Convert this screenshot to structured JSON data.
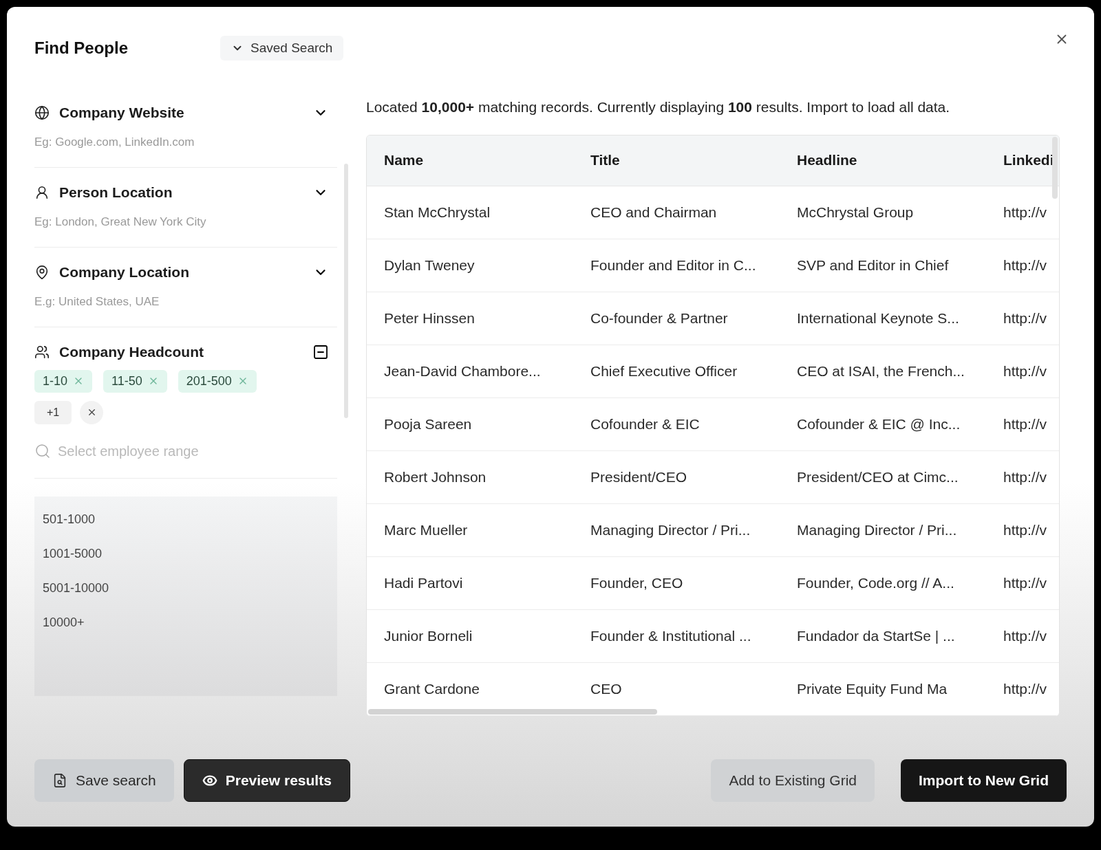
{
  "dialog": {
    "title": "Find People",
    "saved_search": "Saved Search"
  },
  "filters": [
    {
      "kind": "website",
      "label": "Company Website",
      "placeholder": "Eg: Google.com, LinkedIn.com",
      "expanded": false
    },
    {
      "kind": "person_location",
      "label": "Person Location",
      "placeholder": "Eg: London, Great New York City",
      "expanded": false
    },
    {
      "kind": "company_location",
      "label": "Company Location",
      "placeholder": "E.g: United States, UAE",
      "expanded": false
    },
    {
      "kind": "headcount",
      "label": "Company Headcount",
      "expanded": true,
      "tags": [
        "1-10",
        "11-50",
        "201-500"
      ],
      "more": "+1",
      "search_placeholder": "Select employee range",
      "options": [
        "501-1000",
        "1001-5000",
        "5001-10000",
        "10000+"
      ]
    }
  ],
  "summary": "Located **10,000+** matching records. Currently displaying **100** results. Import to load all data.",
  "table": {
    "columns": [
      "Name",
      "Title",
      "Headline",
      "Linkedi"
    ],
    "rows": [
      [
        "Stan McChrystal",
        "CEO and Chairman",
        "McChrystal Group",
        "http://v"
      ],
      [
        "Dylan Tweney",
        "Founder and Editor in C...",
        "SVP and Editor in Chief",
        "http://v"
      ],
      [
        "Peter Hinssen",
        "Co-founder & Partner",
        "International Keynote S...",
        "http://v"
      ],
      [
        "Jean-David Chambore...",
        "Chief Executive Officer",
        "CEO at ISAI, the French...",
        "http://v"
      ],
      [
        "Pooja Sareen",
        "Cofounder & EIC",
        "Cofounder & EIC @ Inc...",
        "http://v"
      ],
      [
        "Robert Johnson",
        "President/CEO",
        "President/CEO at Cimc...",
        "http://v"
      ],
      [
        "Marc Mueller",
        "Managing Director / Pri...",
        "Managing Director / Pri...",
        "http://v"
      ],
      [
        "Hadi Partovi",
        "Founder, CEO",
        "Founder, Code.org // A...",
        "http://v"
      ],
      [
        "Junior Borneli",
        "Founder & Institutional ...",
        "Fundador da StartSe | ...",
        "http://v"
      ],
      [
        "Grant Cardone",
        "CEO",
        "Private Equity Fund Ma",
        "http://v"
      ]
    ]
  },
  "buttons": [
    {
      "kind": "save",
      "label": "Save search"
    },
    {
      "kind": "preview",
      "label": "Preview results"
    },
    {
      "kind": "add",
      "label": "Add to Existing Grid"
    },
    {
      "kind": "import",
      "label": "Import to New Grid"
    }
  ]
}
